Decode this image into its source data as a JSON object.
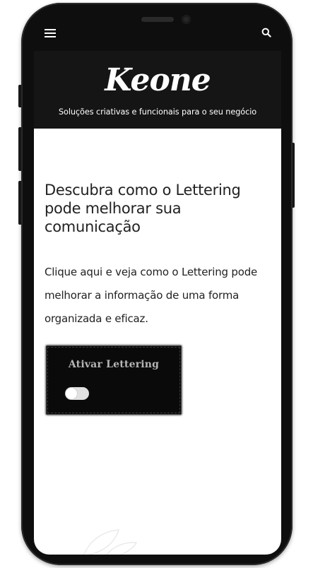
{
  "header": {
    "logo": "Keone",
    "tagline": "Soluções criativas e funcionais para o seu negócio"
  },
  "nav": {
    "menu_icon": "hamburger-menu-icon",
    "search_icon": "search-icon"
  },
  "main": {
    "headline": "Descubra como o Lettering pode melhorar sua comunicação",
    "body": "Clique aqui e veja como o Lettering pode melhorar a informação de uma forma organizada e eficaz."
  },
  "lettering_card": {
    "label": "Ativar Lettering",
    "toggle_on": false
  },
  "colors": {
    "header_bg": "#151515",
    "device_frame": "#0e0e0e",
    "text": "#222222"
  }
}
